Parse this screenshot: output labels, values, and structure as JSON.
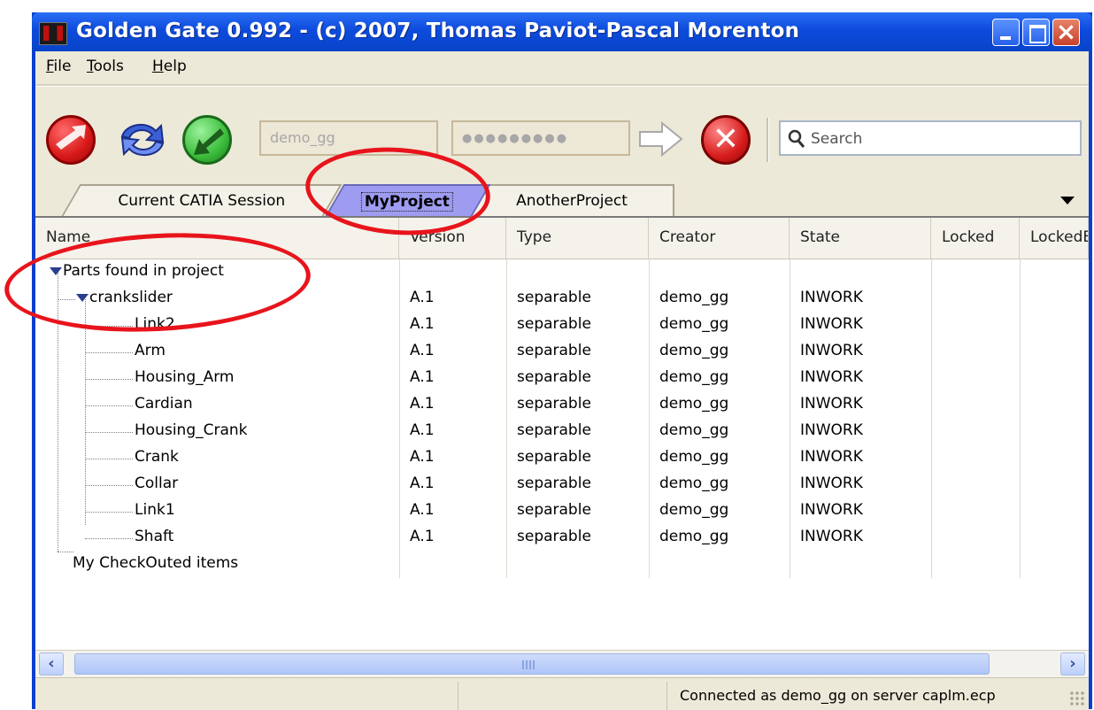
{
  "window": {
    "title": "Golden Gate 0.992 - (c) 2007, Thomas Paviot-Pascal Morenton",
    "close_glyph": "×"
  },
  "menu": [
    {
      "underline": "F",
      "rest": "ile"
    },
    {
      "underline": "T",
      "rest": "ools"
    },
    {
      "underline": "H",
      "rest": "elp"
    }
  ],
  "toolbar": {
    "username": "demo_gg",
    "password": "●●●●●●●●●",
    "search_placeholder": "Search",
    "cancel_glyph": "✕"
  },
  "tabs": [
    "Current CATIA Session",
    "MyProject",
    "AnotherProject"
  ],
  "columns": [
    "Name",
    "Version",
    "Type",
    "Creator",
    "State",
    "Locked",
    "LockedBy"
  ],
  "tree": {
    "root": "Parts found in project",
    "assembly": {
      "name": "crankslider",
      "version": "A.1",
      "type": "separable",
      "creator": "demo_gg",
      "state": "INWORK"
    },
    "parts": [
      {
        "name": "Link2",
        "version": "A.1",
        "type": "separable",
        "creator": "demo_gg",
        "state": "INWORK"
      },
      {
        "name": "Arm",
        "version": "A.1",
        "type": "separable",
        "creator": "demo_gg",
        "state": "INWORK"
      },
      {
        "name": "Housing_Arm",
        "version": "A.1",
        "type": "separable",
        "creator": "demo_gg",
        "state": "INWORK"
      },
      {
        "name": "Cardian",
        "version": "A.1",
        "type": "separable",
        "creator": "demo_gg",
        "state": "INWORK"
      },
      {
        "name": "Housing_Crank",
        "version": "A.1",
        "type": "separable",
        "creator": "demo_gg",
        "state": "INWORK"
      },
      {
        "name": "Crank",
        "version": "A.1",
        "type": "separable",
        "creator": "demo_gg",
        "state": "INWORK"
      },
      {
        "name": "Collar",
        "version": "A.1",
        "type": "separable",
        "creator": "demo_gg",
        "state": "INWORK"
      },
      {
        "name": "Link1",
        "version": "A.1",
        "type": "separable",
        "creator": "demo_gg",
        "state": "INWORK"
      },
      {
        "name": "Shaft",
        "version": "A.1",
        "type": "separable",
        "creator": "demo_gg",
        "state": "INWORK"
      }
    ],
    "other_root": "My CheckOuted items"
  },
  "scrollbar": {
    "left_glyph": "‹",
    "right_glyph": "›"
  },
  "status": "Connected as demo_gg on server caplm.ecp",
  "colors": {
    "annotation": "#e8141c",
    "active_tab": "#9e9cf0",
    "titlebar": "#0d4bdc"
  }
}
